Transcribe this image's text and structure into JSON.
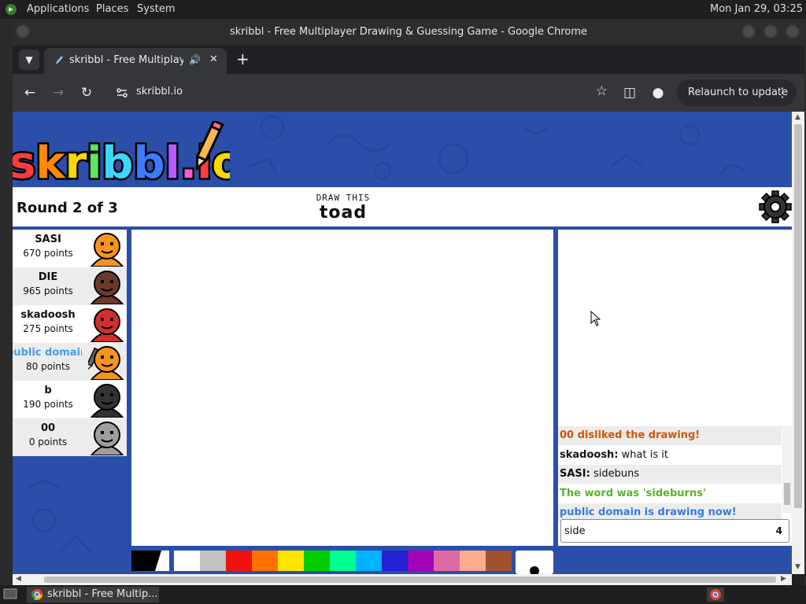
{
  "desktop": {
    "menus": [
      "Applications",
      "Places",
      "System"
    ],
    "clock": "Mon Jan 29, 03:25",
    "taskbar_item": "skribbl - Free Multip..."
  },
  "browser": {
    "window_title": "skribbl - Free Multiplayer Drawing & Guessing Game - Google Chrome",
    "tab_title": "skribbl - Free Multiplayer Drawing & Guessing Game",
    "url": "skribbl.io",
    "relaunch_label": "Relaunch to update"
  },
  "game": {
    "logo": "skribbl.io",
    "round": "Round 2 of 3",
    "draw_this_label": "DRAW THIS",
    "word": "toad",
    "players": [
      {
        "name": "SASI",
        "points": "670 points",
        "skin": "#f7941d",
        "drawing": false
      },
      {
        "name": "DIE",
        "points": "965 points",
        "skin": "#6b3a2a",
        "drawing": false
      },
      {
        "name": "skadoosh",
        "points": "275 points",
        "skin": "#d32f2f",
        "drawing": false
      },
      {
        "name": "public domain (You)",
        "points": "80 points",
        "skin": "#f7941d",
        "drawing": true
      },
      {
        "name": "b",
        "points": "190 points",
        "skin": "#333333",
        "drawing": false
      },
      {
        "name": "00",
        "points": "0 points",
        "skin": "#9e9e9e",
        "drawing": false
      }
    ],
    "chat": [
      {
        "author": "",
        "text": "00 disliked the drawing!",
        "color": "#d35400",
        "bold": true
      },
      {
        "author": "skadoosh:",
        "text": " what is it",
        "color": "#111111",
        "bold": false
      },
      {
        "author": "SASI:",
        "text": " sidebuns",
        "color": "#111111",
        "bold": false
      },
      {
        "author": "",
        "text": "The word was 'sideburns'",
        "color": "#57b42a",
        "bold": true
      },
      {
        "author": "",
        "text": "public domain is drawing now!",
        "color": "#3a7bd5",
        "bold": true
      }
    ],
    "guess_input": "side",
    "guess_count": "4",
    "palette": [
      "#ffffff",
      "#c1c1c1",
      "#ef130b",
      "#ff7100",
      "#ffe400",
      "#00cc00",
      "#00ff91",
      "#00b2ff",
      "#231fd3",
      "#a300ba",
      "#df69a7",
      "#ffac8e",
      "#a0522d"
    ]
  }
}
